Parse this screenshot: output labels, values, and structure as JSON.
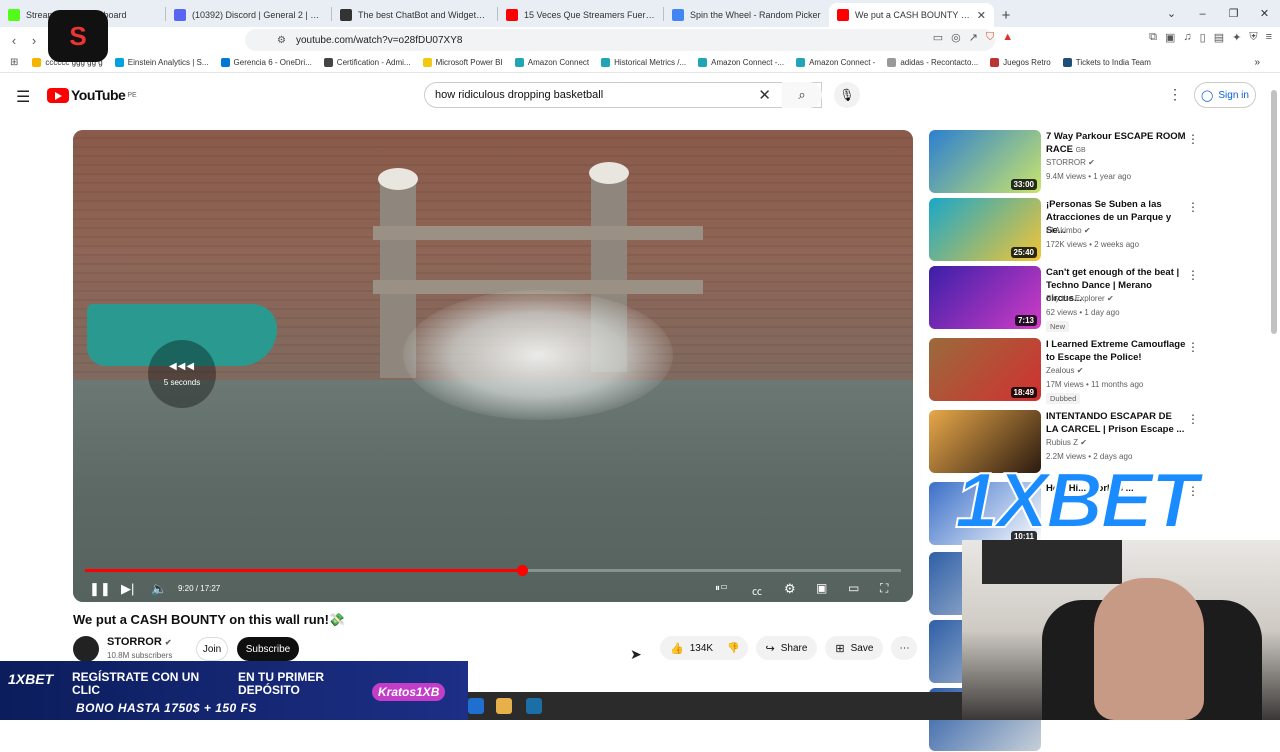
{
  "browser": {
    "tabs": [
      {
        "title": "Stream - Kick Dashboard",
        "color": "#53fc18"
      },
      {
        "title": "(10392) Discord | General 2 | Krat",
        "color": "#5865f2"
      },
      {
        "title": "The best ChatBot and Widgets for Ki",
        "color": "#333333"
      },
      {
        "title": "15 Veces Que Streamers Fueron BAN",
        "color": "#ff0000"
      },
      {
        "title": "Spin the Wheel - Random Picker",
        "color": "#4285f4"
      },
      {
        "title": "We put a CASH BOUNTY on t",
        "color": "#ff0000",
        "active": true
      }
    ],
    "new_tab": "+",
    "url": "youtube.com/watch?v=o28fDU07XY8",
    "bookmarks": [
      {
        "label": "cccccc ggg gg g",
        "color": "#f4b400"
      },
      {
        "label": "Einstein Analytics | S...",
        "color": "#00a1e0"
      },
      {
        "label": "Gerencia 6 - OneDri...",
        "color": "#0078d4"
      },
      {
        "label": "Certification - Admi...",
        "color": "#444444"
      },
      {
        "label": "Microsoft Power BI",
        "color": "#f2c811"
      },
      {
        "label": "Amazon Connect",
        "color": "#1fa5b5"
      },
      {
        "label": "Historical Metrics /...",
        "color": "#1fa5b5"
      },
      {
        "label": "Amazon Connect -...",
        "color": "#1fa5b5"
      },
      {
        "label": "Amazon Connect -",
        "color": "#1fa5b5"
      },
      {
        "label": "adidas - Recontacto...",
        "color": "#999999"
      },
      {
        "label": "Juegos Retro",
        "color": "#b33"
      },
      {
        "label": "Tickets to India Team",
        "color": "#1f4e79"
      }
    ],
    "more_bookmarks": "»"
  },
  "youtube": {
    "logo_text": "YouTube",
    "region": "PE",
    "search_value": "how ridiculous dropping basketball",
    "sign_in": "Sign in",
    "video": {
      "seek_hint": "5 seconds",
      "time": "9:20 / 17:27",
      "progress": 0.535,
      "title": "We put a CASH BOUNTY on this wall run!💸",
      "channel": "STORROR",
      "subscribers": "10.8M subscribers",
      "join": "Join",
      "subscribe": "Subscribe",
      "likes": "134K",
      "share": "Share",
      "save": "Save"
    },
    "recommendations": [
      {
        "title": "7 Way Parkour ESCAPE ROOM RACE",
        "badge": "GB",
        "channel": "STORROR",
        "meta": "9.4M views • 1 year ago",
        "duration": "33:00",
        "thumb": [
          "#2b7fd1",
          "#c9e56b"
        ]
      },
      {
        "title": "¡Personas Se Suben a las Atracciones de un Parque y Se...",
        "channel": "El Akimbo",
        "meta": "172K views • 2 weeks ago",
        "duration": "25:40",
        "thumb": [
          "#1aa7c9",
          "#f4c534"
        ]
      },
      {
        "title": "Can't get enough of the beat | Techno Dance | Merano circus...",
        "channel": "Sky the Explorer",
        "meta": "62 views • 1 day ago",
        "tag": "New",
        "duration": "7:13",
        "thumb": [
          "#3a1fa8",
          "#d13cc6"
        ]
      },
      {
        "title": "I Learned Extreme Camouflage to Escape the Police!",
        "channel": "Zealous",
        "meta": "17M views • 11 months ago",
        "tag": "Dubbed",
        "duration": "18:49",
        "thumb": [
          "#9a6b3c",
          "#d13030"
        ]
      },
      {
        "title": "INTENTANDO ESCAPAR DE LA CARCEL | Prison Escape ...",
        "channel": "Rubius Z",
        "meta": "2.2M views • 2 days ago",
        "thumb": [
          "#e8a84a",
          "#2b1a10"
        ]
      },
      {
        "title": "How Hi... World's ...",
        "channel": "",
        "meta": "",
        "duration": "10:11",
        "thumb": [
          "#3a6fc8",
          "#ffffff"
        ]
      }
    ]
  },
  "overlays": {
    "logo_letter": "S",
    "bet_brand": "1XBET",
    "banner": {
      "brand": "1XBET",
      "line1": "REGÍSTRATE CON UN CLIC",
      "line2": "EN TU PRIMER DEPÓSITO",
      "tag": "Kratos1XB",
      "bonus": "BONO HASTA 1750$ + 150 FS"
    }
  }
}
